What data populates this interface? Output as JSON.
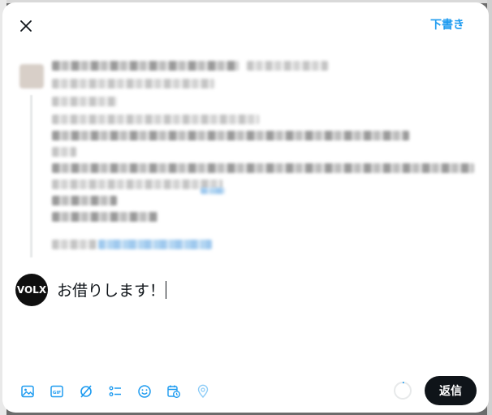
{
  "header": {
    "close_icon": "close-icon",
    "draft_label": "下書き"
  },
  "reply": {
    "avatar_text": "VOLX",
    "text": "お借りします！"
  },
  "toolbar": {
    "icons": [
      "image-icon",
      "gif-icon",
      "grok-icon",
      "poll-icon",
      "emoji-icon",
      "schedule-icon",
      "location-icon"
    ],
    "reply_label": "返信"
  },
  "colors": {
    "accent": "#1d9bf0",
    "button_bg": "#0f1419",
    "text": "#0f1419"
  }
}
